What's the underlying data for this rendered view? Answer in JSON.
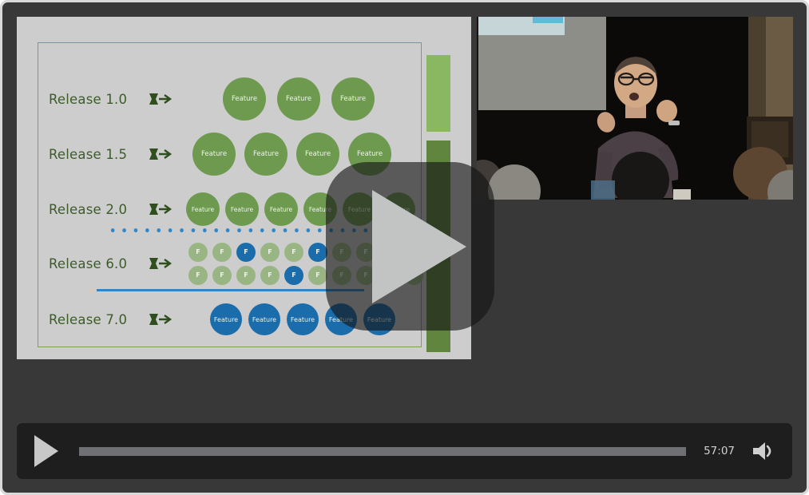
{
  "player": {
    "center_play_icon": "play-triangle-icon",
    "controls": {
      "play_icon": "play-triangle-icon",
      "time": "57:07",
      "volume_icon": "speaker-volume-icon",
      "progress_percent": 0
    }
  },
  "slide": {
    "accent_green": "#6d9a4f",
    "accent_blue": "#1b6cab",
    "accent_sage": "#9ab584",
    "border_green": "#7ba05b",
    "background": "#cdcdcd",
    "bars": [
      {
        "name": "green-bar-top",
        "color": "#8ab862"
      },
      {
        "name": "green-bar-bottom",
        "color": "#60853f"
      }
    ],
    "arrow_icon": "release-arrow-icon",
    "rows": [
      {
        "label": "Release 1.0",
        "arrow": "release-arrow-icon",
        "size": "xl",
        "style": "green",
        "features": [
          "Feature",
          "Feature",
          "Feature"
        ]
      },
      {
        "label": "Release 1.5",
        "arrow": "release-arrow-icon",
        "size": "lg",
        "style": "green",
        "features": [
          "Feature",
          "Feature",
          "Feature",
          "Feature"
        ]
      },
      {
        "label": "Release 2.0",
        "arrow": "release-arrow-icon",
        "size": "md",
        "style": "green",
        "features": [
          "Feature",
          "Feature",
          "Feature",
          "Feature",
          "Feature",
          "Feature"
        ]
      },
      {
        "label": "Release 6.0",
        "arrow": "release-arrow-icon",
        "size": "xs",
        "style": "sage",
        "stacked": true,
        "line_one": [
          {
            "text": "F",
            "style": "sage"
          },
          {
            "text": "F",
            "style": "sage"
          },
          {
            "text": "F",
            "style": "blue"
          },
          {
            "text": "F",
            "style": "sage"
          },
          {
            "text": "F",
            "style": "sage"
          },
          {
            "text": "F",
            "style": "blue"
          },
          {
            "text": "F",
            "style": "sage"
          },
          {
            "text": "F",
            "style": "sage"
          },
          {
            "text": "F",
            "style": "blue"
          },
          {
            "text": "F",
            "style": "sage"
          }
        ],
        "line_two": [
          {
            "text": "F",
            "style": "sage"
          },
          {
            "text": "F",
            "style": "sage"
          },
          {
            "text": "F",
            "style": "sage"
          },
          {
            "text": "F",
            "style": "sage"
          },
          {
            "text": "F",
            "style": "blue"
          },
          {
            "text": "F",
            "style": "sage"
          },
          {
            "text": "F",
            "style": "sage"
          },
          {
            "text": "F",
            "style": "sage"
          },
          {
            "text": "F",
            "style": "blue"
          },
          {
            "text": "F",
            "style": "sage"
          }
        ]
      },
      {
        "label": "Release 7.0",
        "arrow": "release-arrow-icon",
        "size": "sm",
        "style": "blue",
        "features": [
          "Feature",
          "Feature",
          "Feature",
          "Feature",
          "Feature"
        ]
      }
    ],
    "separators": [
      {
        "name": "dotted-separator-line",
        "color": "#2f86c8",
        "style": "dotted"
      },
      {
        "name": "solid-separator-line",
        "color": "#2f86c8",
        "style": "solid"
      }
    ]
  },
  "webcam": {
    "description": "conference-speaker-video"
  }
}
